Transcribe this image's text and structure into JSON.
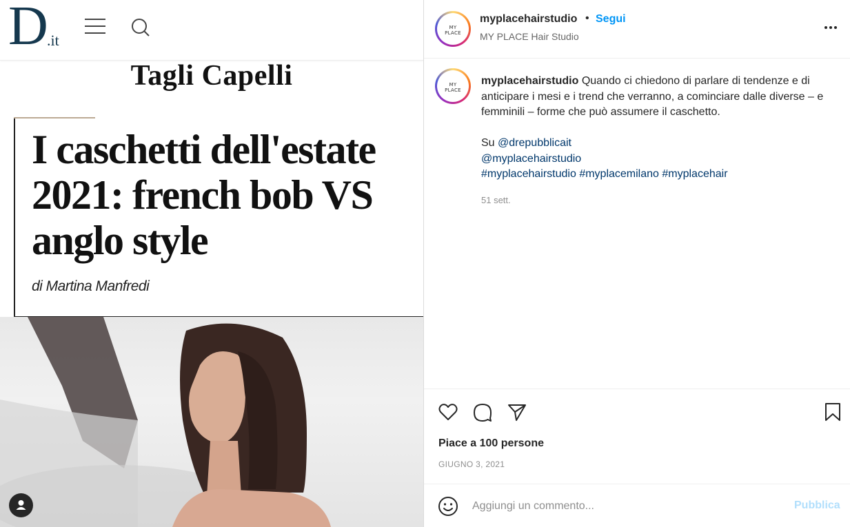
{
  "image": {
    "logo_main": "D",
    "logo_suffix": ".it",
    "section_title": "Tagli Capelli",
    "article_title": "I caschetti dell'estate 2021: french bob VS anglo style",
    "article_author": "di Martina Manfredi"
  },
  "post": {
    "username": "myplacehairstudio",
    "separator": "•",
    "follow_label": "Segui",
    "subtitle": "MY PLACE Hair Studio",
    "avatar_text": "MY PLACE",
    "caption": {
      "username": "myplacehairstudio",
      "text": "Quando ci chiedono di parlare di tendenze e di anticipare i mesi e i trend che verranno, a cominciare dalle diverse – e femminili – forme che può assumere il caschetto.",
      "mention_prefix": "Su",
      "mention1": "@drepubblicait",
      "mention2": "@myplacehairstudio",
      "hashtag1": "#myplacehairstudio",
      "hashtag2": "#myplacemilano",
      "hashtag3": "#myplacehair"
    },
    "time_ago": "51 sett.",
    "likes": "Piace a 100 persone",
    "date": "GIUGNO 3, 2021",
    "comment_placeholder": "Aggiungi un commento...",
    "publish_label": "Pubblica"
  },
  "colors": {
    "brand_blue": "#15384e",
    "follow_blue": "#0095f6",
    "publish_disabled": "#b2dffc",
    "hashtag": "#00376b"
  }
}
